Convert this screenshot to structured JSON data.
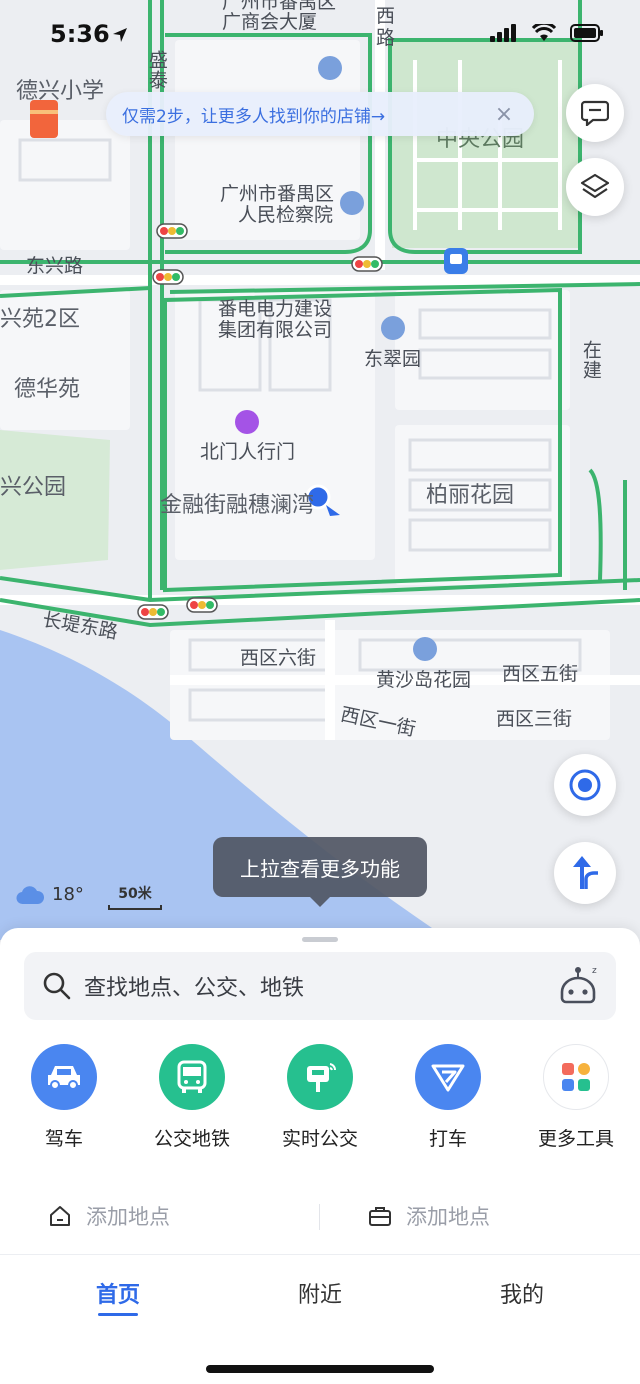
{
  "status": {
    "time": "5:36"
  },
  "banner": {
    "text": "仅需2步，让更多人找到你的店铺→",
    "close_glyph": "×"
  },
  "map": {
    "labels": {
      "pingan_a": "广州市番禺区",
      "pingan_b": "广商会大厦",
      "road_xi": "西",
      "road_lu": "路",
      "dexing_school": "德兴小学",
      "shengtai": "盛泰",
      "central_park": "中央公园",
      "procuratorate_a": "广州市番禺区",
      "procuratorate_b": "人民检察院",
      "dongxing_road": "东兴路",
      "xingyuan2": "兴苑2区",
      "power_co_a": "番电电力建设",
      "power_co_b": "集团有限公司",
      "dongcuiyuan": "东翠园",
      "dehuayuan": "德华苑",
      "under_construction": "在建",
      "beimen": "北门人行门",
      "jinrong": "金融街融穗澜湾",
      "xing_park": "兴公园",
      "bolihuayuan": "柏丽花园",
      "changdi_road": "长堤东路",
      "xiqu6": "西区六街",
      "huangshadao": "黄沙岛花园",
      "xiqu5": "西区五街",
      "xiqu1": "西区一街",
      "xiqu3": "西区三街"
    },
    "tooltip": "上拉查看更多功能",
    "weather": {
      "temp": "18°",
      "icon": "cloud-icon"
    },
    "scale": "50米"
  },
  "search": {
    "placeholder": "查找地点、公交、地铁"
  },
  "tools": [
    {
      "label": "驾车",
      "color": "#4a86f0",
      "icon": "car-icon"
    },
    {
      "label": "公交地铁",
      "color": "#26c08f",
      "icon": "bus-icon"
    },
    {
      "label": "实时公交",
      "color": "#26c08f",
      "icon": "bus-stop-icon"
    },
    {
      "label": "打车",
      "color": "#4a86f0",
      "icon": "taxi-icon"
    },
    {
      "label": "更多工具",
      "color": "#ffffff",
      "icon": "more-tools-icon"
    }
  ],
  "quick": {
    "home": "添加地点",
    "work": "添加地点"
  },
  "tabs": {
    "home": "首页",
    "nearby": "附近",
    "mine": "我的"
  },
  "colors": {
    "accent": "#2f6ae8",
    "road_green": "#3cb46e",
    "water": "#a9c4f2",
    "park": "#cfe7cf"
  }
}
